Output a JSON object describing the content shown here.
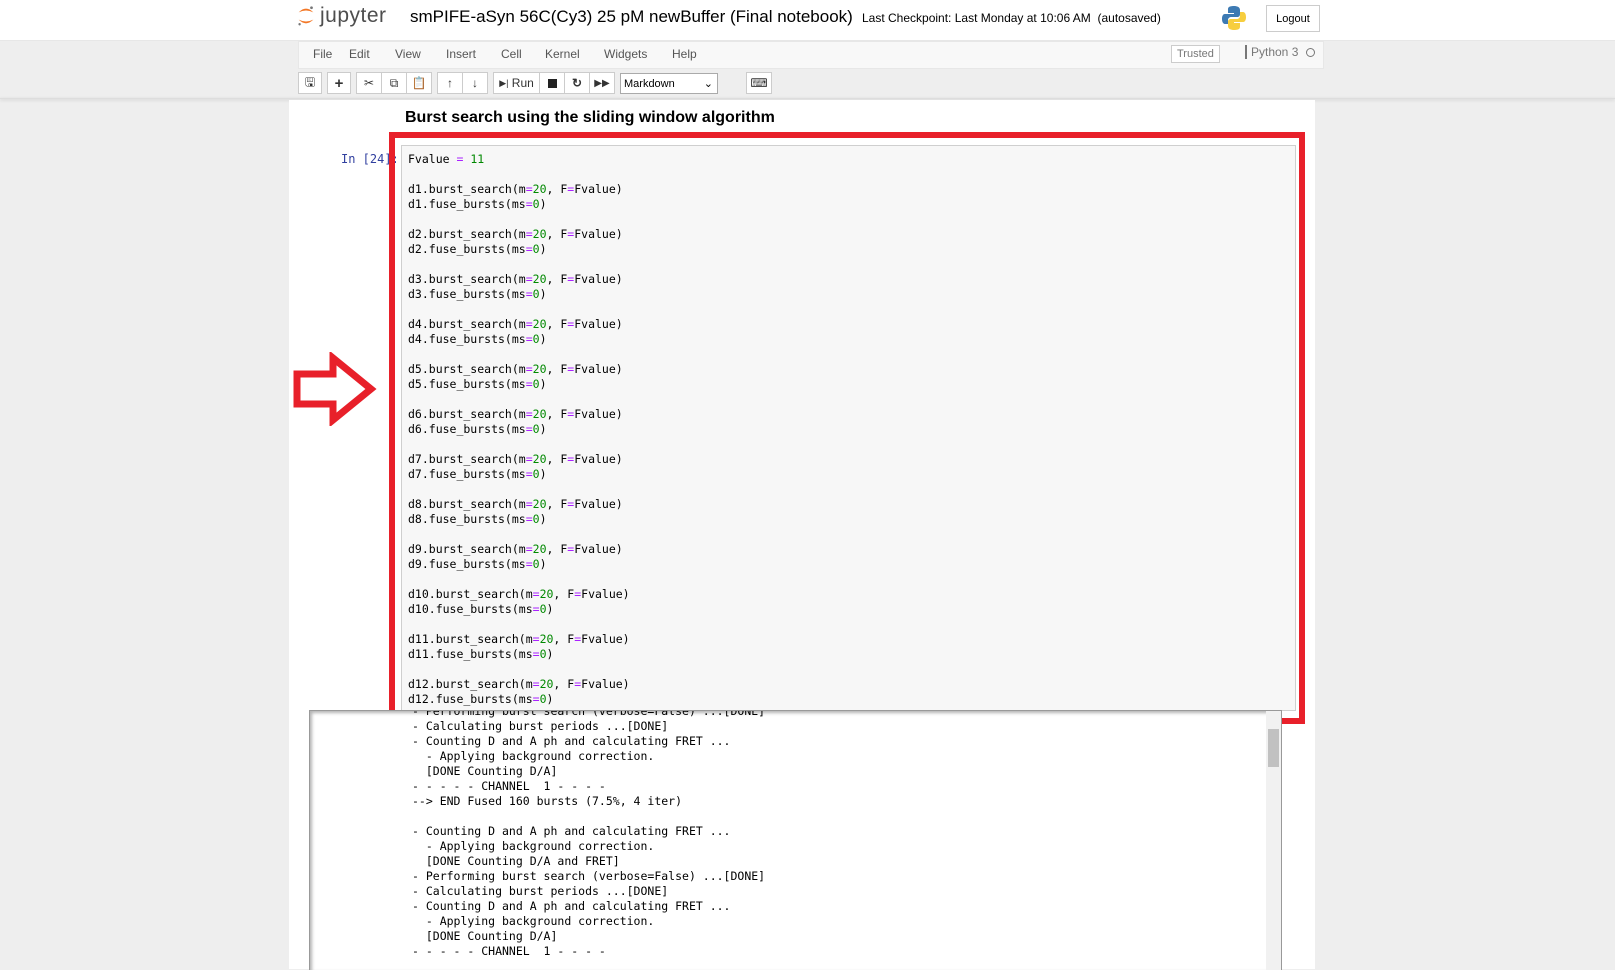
{
  "header": {
    "logo_text": "jupyter",
    "notebook_title": "smPIFE-aSyn 56C(Cy3) 25 pM newBuffer (Final notebook)",
    "checkpoint": "Last Checkpoint: Last Monday at 10:06 AM",
    "autosave": "(autosaved)",
    "logout_label": "Logout"
  },
  "menubar": {
    "items": [
      "File",
      "Edit",
      "View",
      "Insert",
      "Cell",
      "Kernel",
      "Widgets",
      "Help"
    ],
    "trusted": "Trusted",
    "kernel_name": "Python 3"
  },
  "toolbar": {
    "run_label": "Run",
    "cell_type": "Markdown"
  },
  "notebook": {
    "heading": "Burst search using the sliding window algorithm",
    "prompt": "In [24]:",
    "code_lines": [
      "Fvalue = 11",
      "",
      "d1.burst_search(m=20, F=Fvalue)",
      "d1.fuse_bursts(ms=0)",
      "",
      "d2.burst_search(m=20, F=Fvalue)",
      "d2.fuse_bursts(ms=0)",
      "",
      "d3.burst_search(m=20, F=Fvalue)",
      "d3.fuse_bursts(ms=0)",
      "",
      "d4.burst_search(m=20, F=Fvalue)",
      "d4.fuse_bursts(ms=0)",
      "",
      "d5.burst_search(m=20, F=Fvalue)",
      "d5.fuse_bursts(ms=0)",
      "",
      "d6.burst_search(m=20, F=Fvalue)",
      "d6.fuse_bursts(ms=0)",
      "",
      "d7.burst_search(m=20, F=Fvalue)",
      "d7.fuse_bursts(ms=0)",
      "",
      "d8.burst_search(m=20, F=Fvalue)",
      "d8.fuse_bursts(ms=0)",
      "",
      "d9.burst_search(m=20, F=Fvalue)",
      "d9.fuse_bursts(ms=0)",
      "",
      "d10.burst_search(m=20, F=Fvalue)",
      "d10.fuse_bursts(ms=0)",
      "",
      "d11.burst_search(m=20, F=Fvalue)",
      "d11.fuse_bursts(ms=0)",
      "",
      "d12.burst_search(m=20, F=Fvalue)",
      "d12.fuse_bursts(ms=0)"
    ],
    "output_lines": [
      "- Performing burst search (verbose=False) ...[DONE]",
      "- Calculating burst periods ...[DONE]",
      "- Counting D and A ph and calculating FRET ...",
      "  - Applying background correction.",
      "  [DONE Counting D/A]",
      "- - - - - CHANNEL  1 - - - -",
      "--> END Fused 160 bursts (7.5%, 4 iter)",
      "",
      "- Counting D and A ph and calculating FRET ...",
      "  - Applying background correction.",
      "  [DONE Counting D/A and FRET]",
      "- Performing burst search (verbose=False) ...[DONE]",
      "- Calculating burst periods ...[DONE]",
      "- Counting D and A ph and calculating FRET ...",
      "  - Applying background correction.",
      "  [DONE Counting D/A]",
      "- - - - - CHANNEL  1 - - - -"
    ]
  },
  "colors": {
    "highlight": "#e8202a",
    "number": "#008800",
    "operator": "#aa22ff",
    "prompt": "#303f9f"
  }
}
